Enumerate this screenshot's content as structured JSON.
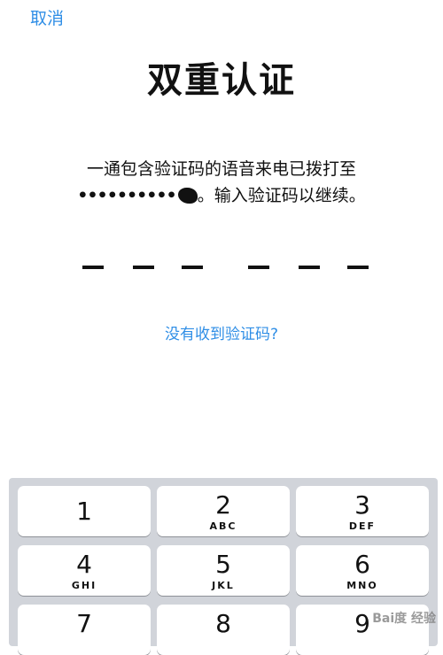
{
  "header": {
    "cancel_label": "取消"
  },
  "title": "双重认证",
  "message": {
    "line1": "一通包含验证码的语音来电已拨打至",
    "masked_number": "••••••••••",
    "line2_suffix": "。输入验证码以继续。"
  },
  "no_code_link": "没有收到验证码?",
  "keypad": {
    "keys": [
      {
        "num": "1",
        "letters": ""
      },
      {
        "num": "2",
        "letters": "ABC"
      },
      {
        "num": "3",
        "letters": "DEF"
      },
      {
        "num": "4",
        "letters": "GHI"
      },
      {
        "num": "5",
        "letters": "JKL"
      },
      {
        "num": "6",
        "letters": "MNO"
      },
      {
        "num": "7",
        "letters": ""
      },
      {
        "num": "8",
        "letters": ""
      },
      {
        "num": "9",
        "letters": ""
      }
    ]
  },
  "watermark": "Bai度 经验",
  "colors": {
    "accent": "#2f8ee6",
    "keyboard_bg": "#d1d4da",
    "key_bg": "#ffffff"
  }
}
